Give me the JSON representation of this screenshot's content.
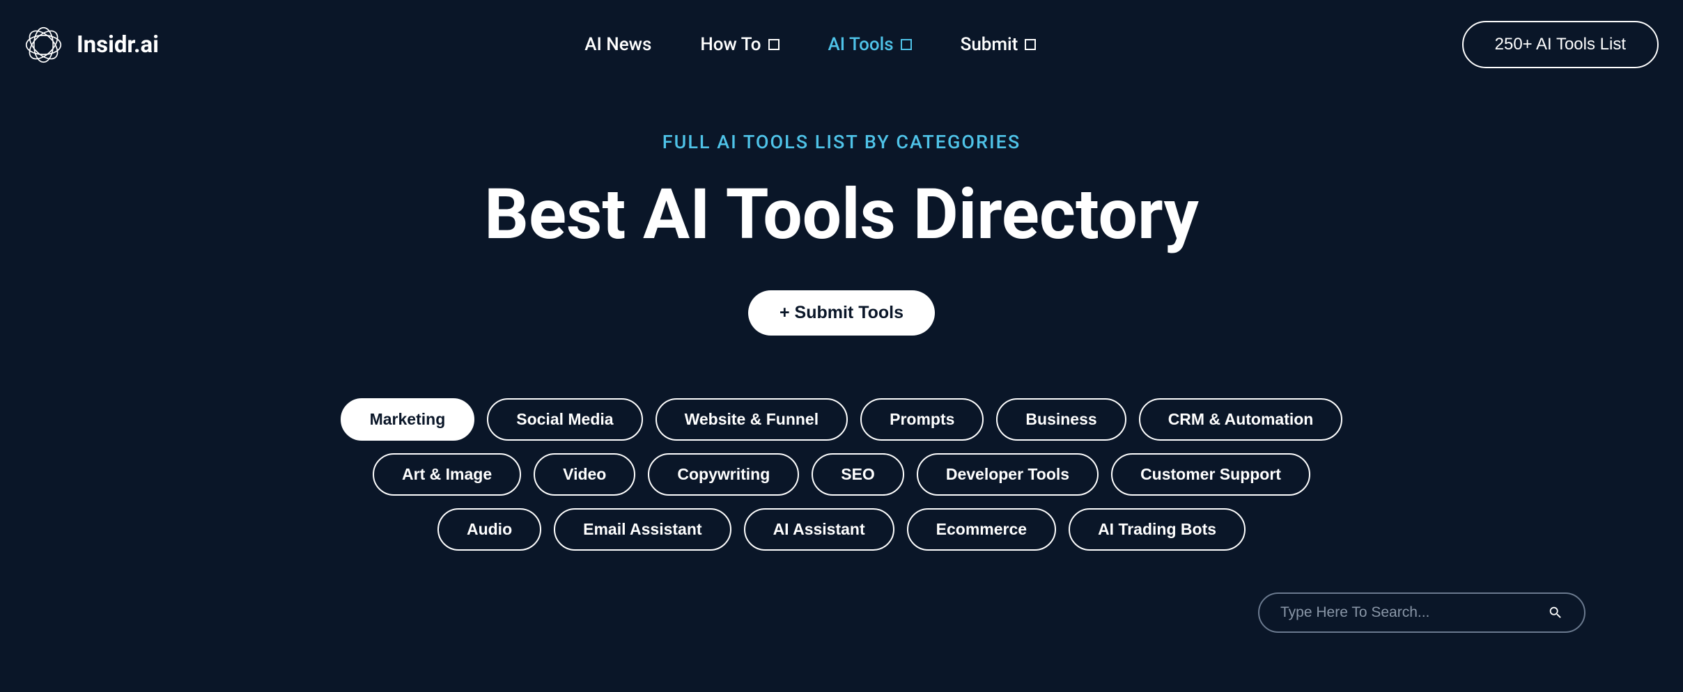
{
  "brand": {
    "name": "Insidr.ai"
  },
  "nav": {
    "items": [
      {
        "label": "AI News",
        "hasDropdown": false,
        "active": false
      },
      {
        "label": "How To",
        "hasDropdown": true,
        "active": false
      },
      {
        "label": "AI Tools",
        "hasDropdown": true,
        "active": true
      },
      {
        "label": "Submit",
        "hasDropdown": true,
        "active": false
      }
    ],
    "cta": "250+ AI Tools List"
  },
  "hero": {
    "subtitle": "FULL AI TOOLS LIST BY CATEGORIES",
    "title": "Best AI Tools Directory",
    "submitButton": "+ Submit Tools"
  },
  "categories": [
    {
      "label": "Marketing",
      "active": true
    },
    {
      "label": "Social Media",
      "active": false
    },
    {
      "label": "Website & Funnel",
      "active": false
    },
    {
      "label": "Prompts",
      "active": false
    },
    {
      "label": "Business",
      "active": false
    },
    {
      "label": "CRM & Automation",
      "active": false
    },
    {
      "label": "Art & Image",
      "active": false
    },
    {
      "label": "Video",
      "active": false
    },
    {
      "label": "Copywriting",
      "active": false
    },
    {
      "label": "SEO",
      "active": false
    },
    {
      "label": "Developer Tools",
      "active": false
    },
    {
      "label": "Customer Support",
      "active": false
    },
    {
      "label": "Audio",
      "active": false
    },
    {
      "label": "Email Assistant",
      "active": false
    },
    {
      "label": "AI Assistant",
      "active": false
    },
    {
      "label": "Ecommerce",
      "active": false
    },
    {
      "label": "AI Trading Bots",
      "active": false
    }
  ],
  "search": {
    "placeholder": "Type Here To Search..."
  }
}
